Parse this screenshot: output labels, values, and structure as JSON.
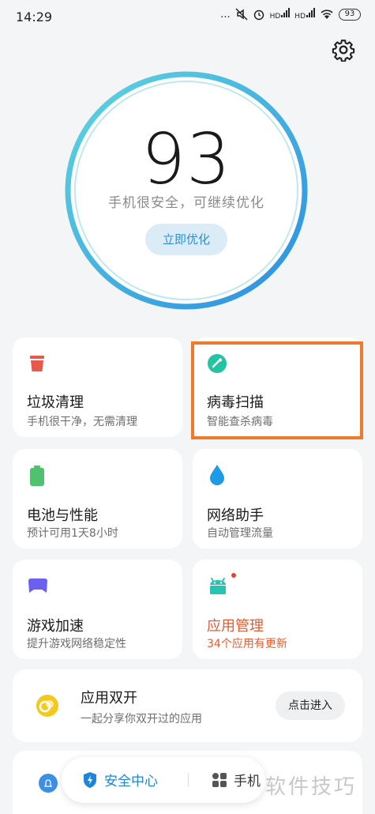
{
  "status_bar": {
    "time": "14:29",
    "dots": "...",
    "hd1": "HD",
    "hd2": "HD",
    "battery": "93"
  },
  "score": {
    "value": "93",
    "message": "手机很安全，可继续优化",
    "optimize_label": "立即优化"
  },
  "cards": {
    "trash": {
      "title": "垃圾清理",
      "subtitle": "手机很干净，无需清理",
      "icon": "trash-bin-icon",
      "color": "#e8594b"
    },
    "virus": {
      "title": "病毒扫描",
      "subtitle": "智能查杀病毒",
      "icon": "shield-scan-icon",
      "color": "#22c4a2"
    },
    "battery": {
      "title": "电池与性能",
      "subtitle": "预计可用1天8小时",
      "icon": "battery-icon",
      "color": "#4fc16f"
    },
    "network": {
      "title": "网络助手",
      "subtitle": "自动管理流量",
      "icon": "water-drop-icon",
      "color": "#1f9be6"
    },
    "game": {
      "title": "游戏加速",
      "subtitle": "提升游戏网络稳定性",
      "icon": "gamepad-icon",
      "color": "#6b5ff0"
    },
    "apps": {
      "title": "应用管理",
      "subtitle": "34个应用有更新",
      "icon": "android-icon",
      "color": "#28c4b2",
      "alert_color": "#e55a2f"
    }
  },
  "dual_apps": {
    "title": "应用双开",
    "subtitle": "一起分享你双开过的应用",
    "enter_label": "点击进入",
    "icon": "dual-app-icon"
  },
  "bottom_nav": {
    "tab_security": "安全中心",
    "tab_phone": "手机"
  },
  "watermark": "软件技巧"
}
